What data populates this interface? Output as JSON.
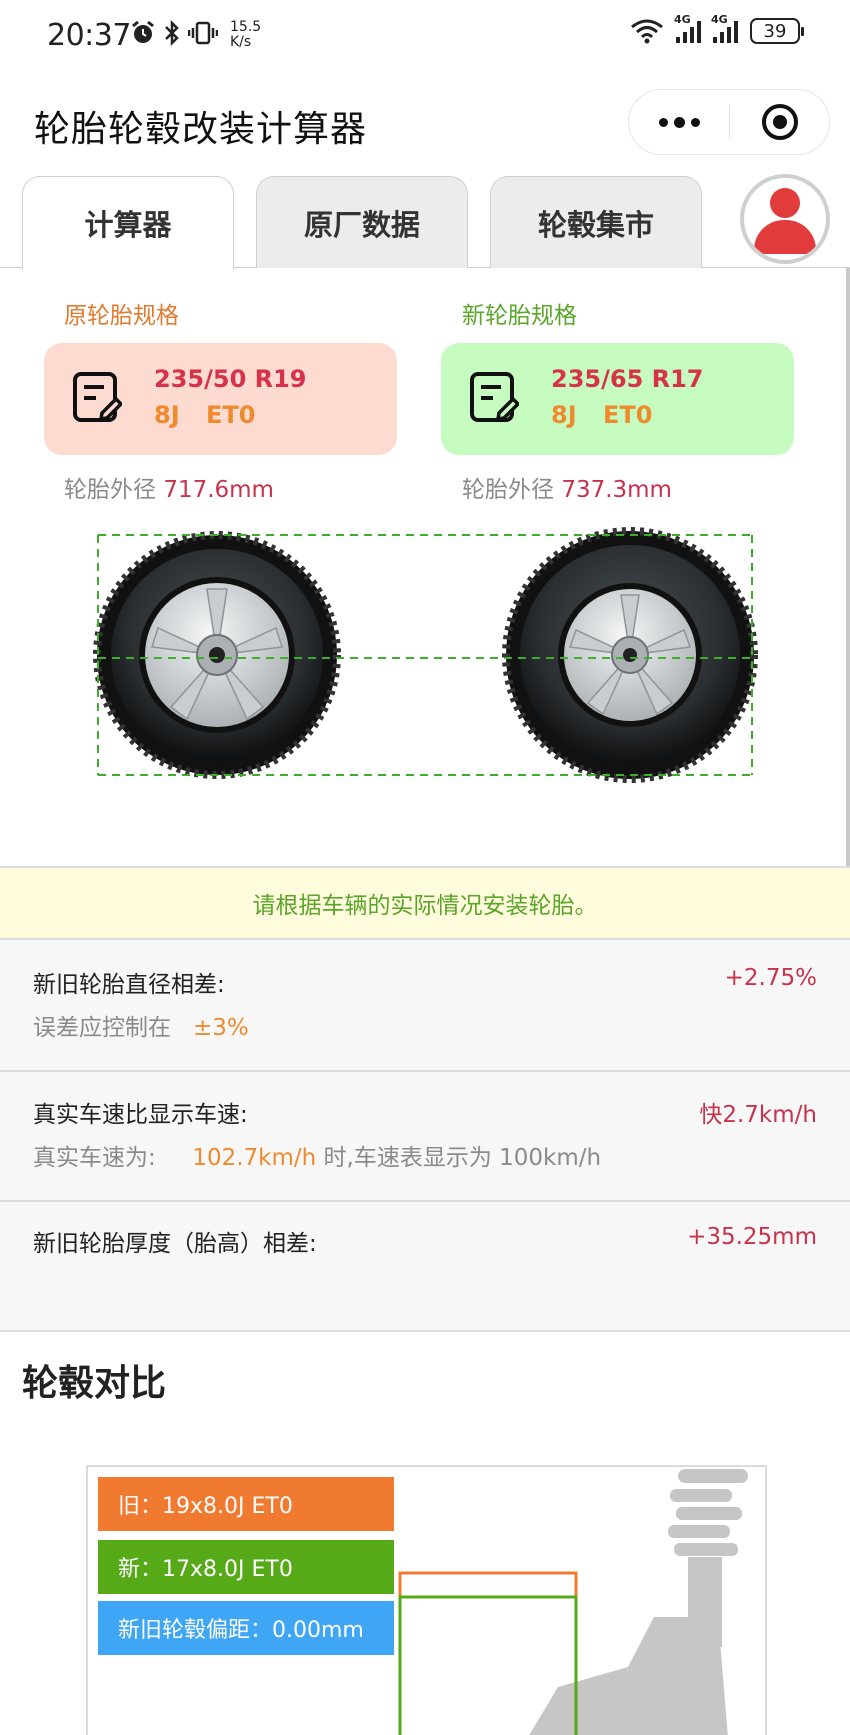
{
  "status_bar": {
    "time": "20:37",
    "net_speed_value": "15.5",
    "net_speed_unit": "K/s",
    "signal1_label": "4G",
    "signal2_label": "4G",
    "battery": "39",
    "icons": [
      "alarm-icon",
      "bluetooth-icon",
      "vibrate-icon",
      "wifi-icon",
      "signal-icon",
      "battery-icon"
    ]
  },
  "header": {
    "title": "轮胎轮毂改装计算器"
  },
  "tabs": [
    {
      "label": "计算器",
      "active": true
    },
    {
      "label": "原厂数据",
      "active": false
    },
    {
      "label": "轮毂集市",
      "active": false
    }
  ],
  "specs": {
    "old": {
      "label": "原轮胎规格",
      "tire": "235/50 R19",
      "rim": "8J ET0",
      "diameter_label": "轮胎外径",
      "diameter_value": "717.6mm",
      "card_color": "#fddbd0"
    },
    "new": {
      "label": "新轮胎规格",
      "tire": "235/65 R17",
      "rim": "8J ET0",
      "diameter_label": "轮胎外径",
      "diameter_value": "737.3mm",
      "card_color": "#c6fcc0"
    }
  },
  "notice": "请根据车辆的实际情况安装轮胎。",
  "results": {
    "diameter": {
      "title": "新旧轮胎直径相差:",
      "value": "+2.75%",
      "sub_prefix": "误差应控制在",
      "sub_highlight": "±3%"
    },
    "speed": {
      "title": "真实车速比显示车速:",
      "value": "快2.7km/h",
      "sub_prefix": "真实车速为:",
      "sub_highlight": "102.7km/h",
      "sub_suffix": "时,车速表显示为 100km/h"
    },
    "thickness": {
      "title": "新旧轮胎厚度（胎高）相差:",
      "value": "+35.25mm"
    }
  },
  "rim_compare": {
    "section_title": "轮毂对比",
    "old_tag": "旧：19x8.0J ET0",
    "new_tag": "新：17x8.0J ET0",
    "offset_tag": "新旧轮毂偏距：0.00mm"
  },
  "colors": {
    "accent_red": "#c7334d",
    "accent_orange": "#ef8a2e",
    "accent_green": "#5aa52a",
    "tag_blue": "#3ea6f5"
  }
}
